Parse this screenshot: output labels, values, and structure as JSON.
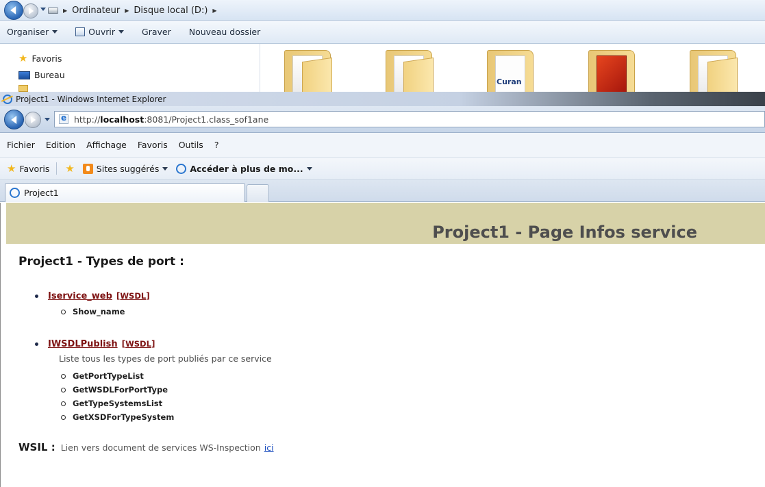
{
  "explorer": {
    "breadcrumbs": [
      "Ordinateur",
      "Disque local (D:)"
    ],
    "commands": [
      "Organiser",
      "Ouvrir",
      "Graver",
      "Nouveau dossier"
    ],
    "nav_items": [
      "Favoris",
      "Bureau"
    ],
    "folder_icon_text": "Curan"
  },
  "ie": {
    "window_title": "Project1 - Windows Internet Explorer",
    "url_prefix": "http://",
    "url_host": "localhost",
    "url_rest": ":8081/Project1.class_sof1ane",
    "menu": [
      "Fichier",
      "Edition",
      "Affichage",
      "Favoris",
      "Outils",
      "?"
    ],
    "favorites_bar": {
      "favoris": "Favoris",
      "sites_suggeres": "Sites suggérés",
      "acceder": "Accéder à plus de mo..."
    },
    "tab_title": "Project1"
  },
  "page": {
    "header_title": "Project1 - Page Infos service",
    "section_title": "Project1 - Types de port :",
    "wsdl_label": "WSDL",
    "ports": [
      {
        "name": "Iservice_web",
        "description": "",
        "operations": [
          "Show_name"
        ]
      },
      {
        "name": "IWSDLPublish",
        "description": "Liste tous les types de port publiés par ce service",
        "operations": [
          "GetPortTypeList",
          "GetWSDLForPortType",
          "GetTypeSystemsList",
          "GetXSDForTypeSystem"
        ]
      }
    ],
    "wsil": {
      "label": "WSIL :",
      "text": "Lien vers document de services WS-Inspection",
      "link": "ici"
    }
  },
  "colors": {
    "header_band": "#d7d2a8",
    "port_link": "#7e1313",
    "hyperlink": "#1d4fbf"
  }
}
